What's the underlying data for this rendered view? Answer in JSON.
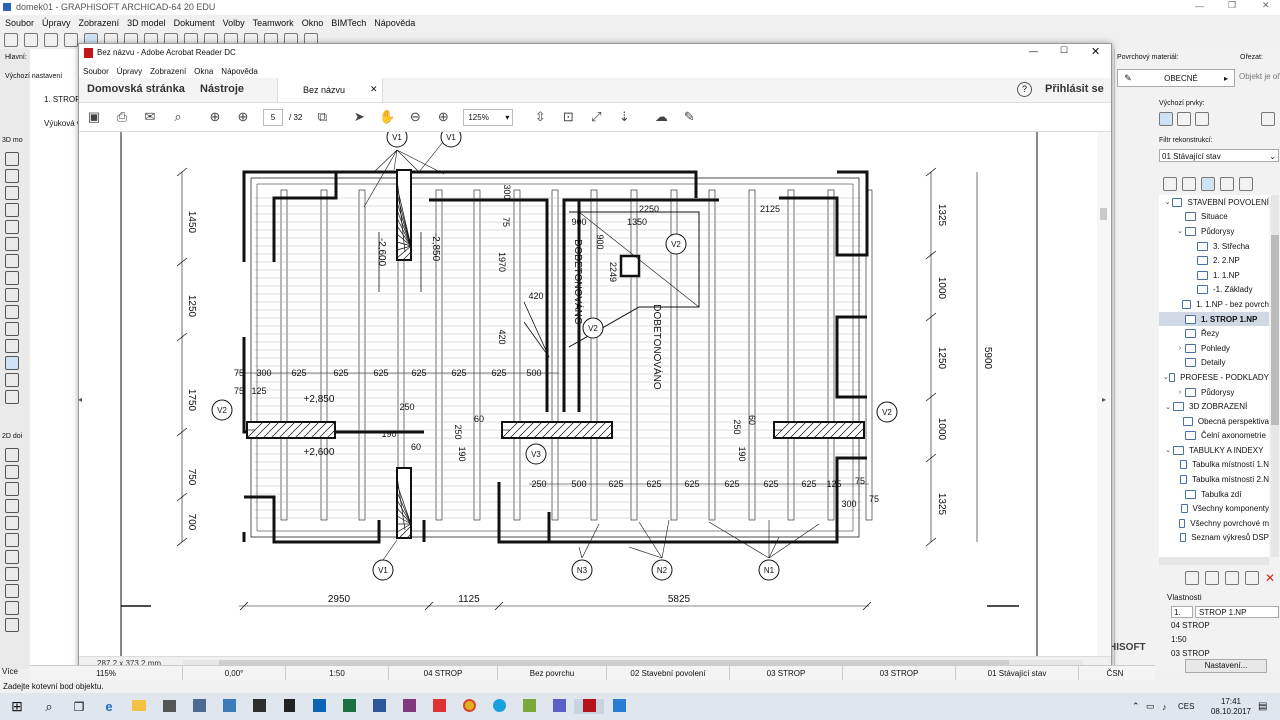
{
  "archicad": {
    "title": "domek01 - GRAPHISOFT ARCHICAD-64 20 EDU",
    "menu": [
      "Soubor",
      "Úpravy",
      "Zobrazení",
      "3D model",
      "Dokument",
      "Volby",
      "Teamwork",
      "Okno",
      "BIMTech",
      "Nápověda"
    ],
    "left_labels": {
      "main": "Hlavní:",
      "default": "Výchozí nastavení",
      "3d": "3D mo",
      "2d": "2D doi",
      "more": "Více"
    },
    "tab_label": "1. STROP",
    "tab_sub": "Výuková v",
    "right_panel": {
      "surface_label": "Povrchový materiál:",
      "surface_value": "OBECNÉ",
      "cut_label": "Ořezat:",
      "cut_value": "Objekt je oř",
      "defaults_label": "Výchozí prvky:",
      "filter_label": "Filtr rekonstrukcí:",
      "filter_value": "01 Stávající stav"
    },
    "navigator": [
      {
        "label": "STAVEBNÍ POVOLENÍ",
        "indent": 0,
        "arrow": "v",
        "selected": false
      },
      {
        "label": "Situace",
        "indent": 1,
        "arrow": "",
        "selected": false
      },
      {
        "label": "Půdorysy",
        "indent": 1,
        "arrow": "v",
        "selected": false
      },
      {
        "label": "3. Střecha",
        "indent": 2,
        "arrow": "",
        "selected": false
      },
      {
        "label": "2. 2.NP",
        "indent": 2,
        "arrow": "",
        "selected": false
      },
      {
        "label": "1. 1.NP",
        "indent": 2,
        "arrow": "",
        "selected": false
      },
      {
        "label": "-1. Základy",
        "indent": 2,
        "arrow": "",
        "selected": false
      },
      {
        "label": "1. 1.NP - bez povrch",
        "indent": 1,
        "arrow": "",
        "selected": false
      },
      {
        "label": "1. STROP 1.NP",
        "indent": 1,
        "arrow": "",
        "selected": true
      },
      {
        "label": "Řezy",
        "indent": 1,
        "arrow": "",
        "selected": false
      },
      {
        "label": "Pohledy",
        "indent": 1,
        "arrow": ">",
        "selected": false
      },
      {
        "label": "Detaily",
        "indent": 1,
        "arrow": "",
        "selected": false
      },
      {
        "label": "PROFESE - PODKLADY",
        "indent": 0,
        "arrow": "v",
        "selected": false
      },
      {
        "label": "Půdorysy",
        "indent": 1,
        "arrow": ">",
        "selected": false
      },
      {
        "label": "3D ZOBRAZENÍ",
        "indent": 0,
        "arrow": "v",
        "selected": false
      },
      {
        "label": "Obecná perspektiva",
        "indent": 1,
        "arrow": "",
        "selected": false
      },
      {
        "label": "Čelní axonometrie",
        "indent": 1,
        "arrow": "",
        "selected": false
      },
      {
        "label": "TABULKY A INDEXY",
        "indent": 0,
        "arrow": "v",
        "selected": false
      },
      {
        "label": "Tabulka místností 1.N",
        "indent": 1,
        "arrow": "",
        "selected": false
      },
      {
        "label": "Tabulka místností 2.N",
        "indent": 1,
        "arrow": "",
        "selected": false
      },
      {
        "label": "Tabulka zdí",
        "indent": 1,
        "arrow": "",
        "selected": false
      },
      {
        "label": "Všechny komponenty",
        "indent": 1,
        "arrow": "",
        "selected": false
      },
      {
        "label": "Všechny povrchové m",
        "indent": 1,
        "arrow": "",
        "selected": false
      },
      {
        "label": "Seznam výkresů DSP",
        "indent": 1,
        "arrow": "",
        "selected": false
      }
    ],
    "properties": {
      "header": "Vlastnosti",
      "id": "1.",
      "name": "STROP 1.NP",
      "lines": [
        "04 STROP",
        "1:50",
        "03 STROP"
      ],
      "settings_button": "Nastavení..."
    },
    "graphisoft_logo": "HISOFT",
    "status_bar": {
      "zoom": "115%",
      "angle": "0,00°",
      "scale": "1:50",
      "layer": "04 STROP",
      "surface": "Bez povrchu",
      "permit": "02 Stavební povolení",
      "strop1": "03 STROP",
      "strop2": "03 STROP",
      "state": "01 Stávající stav",
      "csn": "ČSN"
    },
    "hint": "Zadejte kotevní bod objektu."
  },
  "acrobat": {
    "title": "Bez názvu - Adobe Acrobat Reader DC",
    "menu": [
      "Soubor",
      "Úpravy",
      "Zobrazení",
      "Okna",
      "Nápověda"
    ],
    "home_tab": "Domovská stránka",
    "tools_tab": "Nástroje",
    "doc_tab": "Bez názvu",
    "help": "?",
    "signin": "Přihlásit se",
    "page_current": "5",
    "page_total": "/ 32",
    "zoom": "125%",
    "page_size": "287,2 x 373,2 mm"
  },
  "drawing": {
    "dims_top_left": [
      "1450",
      "1250",
      "1750",
      "750",
      "700"
    ],
    "dims_right": [
      "1325",
      "1000",
      "1250",
      "1000",
      "1325"
    ],
    "dim_overall_right": "5900",
    "dims_bottom": [
      "2950",
      "1125",
      "5825"
    ],
    "dims_joist": [
      "75",
      "300",
      "625",
      "625",
      "625",
      "625",
      "625",
      "625",
      "500",
      "125",
      "75"
    ],
    "dims_joist_lower": [
      "250",
      "500",
      "625",
      "625",
      "625",
      "625",
      "625",
      "625",
      "125",
      "75",
      "300",
      "75"
    ],
    "levels": [
      "-2,600",
      "-2,850",
      "+2,850",
      "+2,600"
    ],
    "concrete_label": "DOBETONOVÁNO",
    "misc_dims": [
      "900",
      "1350",
      "2250",
      "2125",
      "900",
      "2249",
      "1970",
      "420",
      "420",
      "250",
      "190",
      "60",
      "250",
      "190",
      "60",
      "250",
      "190",
      "60",
      "75",
      "300"
    ],
    "tags": [
      "V1",
      "V2",
      "V2",
      "V3",
      "V2",
      "V2",
      "N1",
      "N2",
      "N3",
      "V1",
      "V1"
    ]
  },
  "taskbar": {
    "time": "17:41",
    "date": "08.10.2017",
    "lang": "CES"
  }
}
